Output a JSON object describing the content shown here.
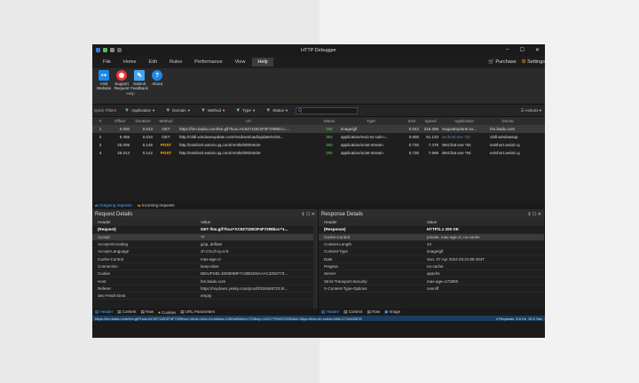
{
  "window": {
    "title": "HTTP Debugger"
  },
  "menu": {
    "items": [
      "File",
      "Home",
      "Edit",
      "Rules",
      "Performance",
      "View",
      "Help"
    ],
    "active": "Help",
    "purchase": "Purchase",
    "settings": "Settings"
  },
  "ribbon": {
    "buttons": [
      {
        "label": "Visit Website",
        "icon": "globe-icon",
        "color": "#1e88e5"
      },
      {
        "label": "Support Request",
        "icon": "lifebuoy-icon",
        "color": "#e53935"
      },
      {
        "label": "Submit Feedback",
        "icon": "feedback-icon",
        "color": "#42a5f5"
      },
      {
        "label": "About",
        "icon": "question-icon",
        "color": "#1e88e5"
      }
    ],
    "group": "Help"
  },
  "filters": {
    "label": "Quick Filters",
    "items": [
      "Application",
      "Domain",
      "Method",
      "Type",
      "Status"
    ],
    "search": "Q",
    "actions": "Actions"
  },
  "grid": {
    "columns": [
      "#",
      "Offset",
      "Duration",
      "Method",
      "Url",
      "Status",
      "Type",
      "Size",
      "Speed",
      "Application",
      "Domai"
    ],
    "rows": [
      [
        "1",
        "0.000",
        "0.013",
        "GET",
        "https://hm.baidu.com/hm.gif?hca=AC9271DE3F4F7299bcc=...",
        "200",
        "image/gif",
        "0.042",
        "216.256",
        "SogouExplorer.ex...",
        "hm.baidu.com"
      ],
      [
        "2",
        "6.455",
        "0.010",
        "GET",
        "http://ctldl.windowsupdate.com/msdownload/update/v3/st...",
        "304",
        "application/vnd.ms-cab-c...",
        "0.000",
        "61.133",
        "svchost.exe *32",
        "ctldl.windowsup"
      ],
      [
        "3",
        "25.009",
        "0.146",
        "POST",
        "http://extshort.weixin.qq.com/mmtls/00004e2e",
        "200",
        "application/octet-stream",
        "0.730",
        "7.478",
        "WeChat.exe *64",
        "extshort.weixin.q"
      ],
      [
        "4",
        "25.013",
        "0.142",
        "POST",
        "http://extshort.weixin.qq.com/mmtls/00004e2e",
        "200",
        "application/octet-stream",
        "0.730",
        "7.689",
        "WeChat.exe *64",
        "extshort.weixin.q"
      ]
    ]
  },
  "reqtabs": {
    "outgoing": "Outgoing requests",
    "incoming": "Incoming requests"
  },
  "request": {
    "title": "Request Details",
    "header_col": "Header",
    "value_col": "Value",
    "rows": [
      [
        "(Request)",
        "GET /hm.gif?hca=AC9271DE3F4F7299bcc=1..."
      ],
      [
        "Accept",
        "*/*"
      ],
      [
        "Accept-Encoding",
        "gzip, deflate"
      ],
      [
        "Accept-Language",
        "zh-CN,zh;q=0.9"
      ],
      [
        "Cache-Control",
        "max-age=0"
      ],
      [
        "Connection",
        "keep-alive"
      ],
      [
        "Cookie",
        "BIDUPSID=DD9E88F7A3881E8AAAC3202773..."
      ],
      [
        "Host",
        "hm.baidu.com"
      ],
      [
        "Referer",
        "https://mydown.yesky.com/pcsoft/334848723.ht..."
      ],
      [
        "Sec-Fetch-Dest",
        "empty"
      ]
    ],
    "tabs": [
      "Header",
      "Content",
      "Raw",
      "Cookies",
      "URL Parameters"
    ]
  },
  "response": {
    "title": "Response Details",
    "header_col": "Header",
    "value_col": "Value",
    "rows": [
      [
        "(Response)",
        "HTTP/1.1 200 OK"
      ],
      [
        "Cache-Control",
        "private, max-age=0, no-cache"
      ],
      [
        "Content-Length",
        "43"
      ],
      [
        "Content-Type",
        "image/gif"
      ],
      [
        "Date",
        "Sun, 07 Apr 2024 03:21:08 GMT"
      ],
      [
        "Pragma",
        "no-cache"
      ],
      [
        "Server",
        "apache"
      ],
      [
        "Strict-Transport-Security",
        "max-age=172800"
      ],
      [
        "X-Content-Type-Options",
        "nosniff"
      ]
    ],
    "tabs": [
      "Header",
      "Content",
      "Raw",
      "Image"
    ]
  },
  "status": {
    "url": "https://hm.baidu.com/hm.gif?hca=AC9271DE3F4F7299bcc=1&ck=1&cl=24-bit&ds=1000x800&vl=723&ep=1421779%2C2930&et=3&ja=0&ln=zh-cn&lo=0&lt=1712452878",
    "requests": "4 Requests",
    "size": "8.6 Kb",
    "time": "25.2 Sec"
  }
}
